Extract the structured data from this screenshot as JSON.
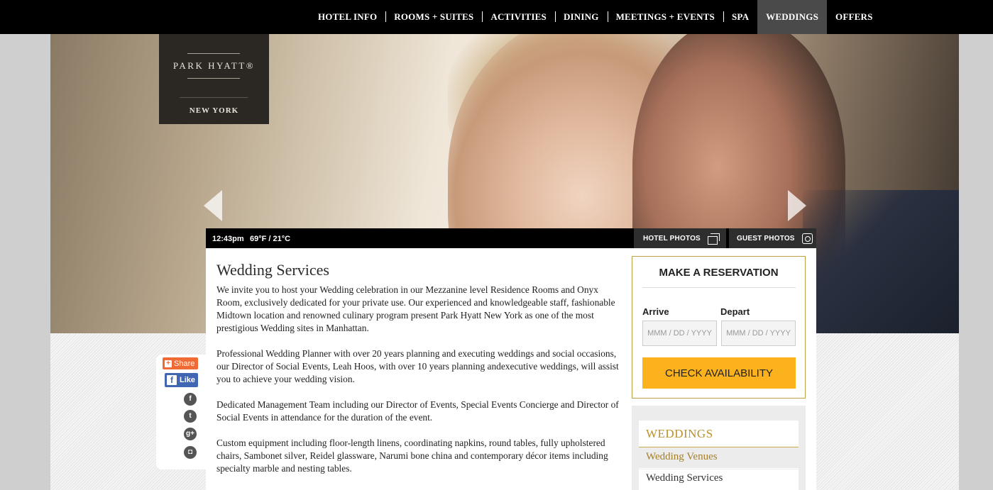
{
  "nav": {
    "items": [
      {
        "label": "HOTEL INFO",
        "active": false
      },
      {
        "label": "ROOMS + SUITES",
        "active": false
      },
      {
        "label": "ACTIVITIES",
        "active": false
      },
      {
        "label": "DINING",
        "active": false
      },
      {
        "label": "MEETINGS + EVENTS",
        "active": false
      },
      {
        "label": "SPA",
        "active": false
      },
      {
        "label": "WEDDINGS",
        "active": true
      },
      {
        "label": "OFFERS",
        "active": false
      }
    ]
  },
  "logo": {
    "brand": "PARK HYATT®",
    "city": "NEW YORK"
  },
  "infobar": {
    "time": "12:43pm",
    "temperature": "69°F / 21°C",
    "hotel_photos": "HOTEL PHOTOS",
    "guest_photos": "GUEST PHOTOS"
  },
  "main": {
    "title": "Wedding Services",
    "paragraphs": [
      "We invite you to host your Wedding celebration in our Mezzanine level Residence Rooms and Onyx Room, exclusively dedicated for your private use. Our experienced and knowledgeable staff, fashionable Midtown location and renowned culinary program present Park Hyatt New York as one of the most prestigious Wedding sites in Manhattan.",
      "Professional Wedding Planner with over 20 years planning and executing weddings and social occasions, our Director of Social Events, Leah Hoos, with over 10 years planning andexecutive weddings,  will assist you to achieve your wedding vision.",
      "Dedicated Management Team including our Director of Events, Special Events Concierge and Director of Social Events in attendance for the duration of the event.",
      "Custom equipment including floor-length linens, coordinating napkins, round tables, fully upholstered chairs, Sambonet silver, Reidel glassware, Narumi bone china and contemporary décor items including specialty marble and nesting tables."
    ]
  },
  "reservation": {
    "title": "MAKE A RESERVATION",
    "arrive_label": "Arrive",
    "depart_label": "Depart",
    "arrive_placeholder": "MMM / DD / YYYY",
    "depart_placeholder": "MMM / DD / YYYY",
    "button_label": "CHECK AVAILABILITY",
    "button_color": "#fbb21c"
  },
  "sidenav": {
    "heading": "WEDDINGS",
    "items": [
      {
        "label": "Wedding Venues"
      },
      {
        "label": "Wedding Services"
      }
    ]
  },
  "social": {
    "share_label": "Share",
    "like_label": "Like",
    "icons": [
      "facebook-icon",
      "twitter-icon",
      "google-plus-icon",
      "instagram-icon"
    ]
  },
  "colors": {
    "gold": "#b9a045",
    "nav_bg": "#000000",
    "nav_active": "#4a4a4a"
  }
}
